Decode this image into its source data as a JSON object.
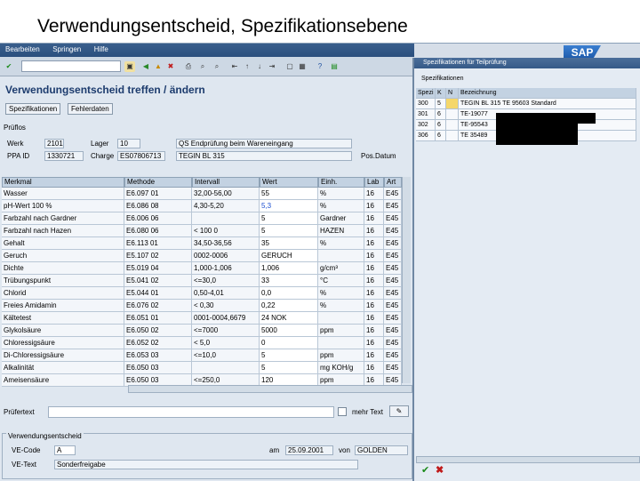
{
  "slide_title": "Verwendungsentscheid, Spezifikationsebene",
  "menu": [
    "Bearbeiten",
    "Springen",
    "Hilfe"
  ],
  "app_title": "Verwendungsentscheid treffen / ändern",
  "buttons": {
    "specs": "Spezifikationen",
    "defects": "Fehlerdaten"
  },
  "pruefung": {
    "group_label": "Prüflos",
    "werk_label": "Werk",
    "werk": "2101",
    "lager_label": "Lager",
    "lager": "10",
    "desc": "QS Endprüfung beim Wareneingang",
    "ppa_label": "PPA ID",
    "ppa": "1330721",
    "charge_label": "Charge",
    "charge": "ES07806713",
    "material": "TEGIN BL 315",
    "pos_label": "Pos.Datum"
  },
  "grid": {
    "headers": [
      "Merkmal",
      "Methode",
      "Intervall",
      "Wert",
      "Einh.",
      "Lab",
      "Art"
    ],
    "rows": [
      [
        "Wasser",
        "E6.097 01",
        "32,00-56,00",
        "55",
        "%",
        "16",
        "E45"
      ],
      [
        "pH-Wert 100 %",
        "E6.086 08",
        "4,30-5,20",
        "5,3",
        "%",
        "16",
        "E45"
      ],
      [
        "Farbzahl nach Gardner",
        "E6.006 06",
        "",
        "5",
        "Gardner",
        "16",
        "E45"
      ],
      [
        "Farbzahl nach Hazen",
        "E6.080 06",
        "< 100 0",
        "5",
        "HAZEN",
        "16",
        "E45"
      ],
      [
        "Gehalt",
        "E6.113 01",
        "34,50-36,56",
        "35",
        "%",
        "16",
        "E45"
      ],
      [
        "Geruch",
        "E5.107 02",
        "0002-0006",
        "GERUCH",
        "",
        "16",
        "E45"
      ],
      [
        "Dichte",
        "E5.019 04",
        "1,000-1,006",
        "1,006",
        "g/cm³",
        "16",
        "E45"
      ],
      [
        "Trübungspunkt",
        "E5.041 02",
        "<=30,0",
        "33",
        "°C",
        "16",
        "E45"
      ],
      [
        "Chlorid",
        "E5.044 01",
        "0,50-4,01",
        "0,0",
        "%",
        "16",
        "E45"
      ],
      [
        "Freies Amidamin",
        "E6.076 02",
        "< 0,30",
        "0,22",
        "%",
        "16",
        "E45"
      ],
      [
        "Kältetest",
        "E6.051 01",
        "0001-0004,6679",
        "24 NOK",
        "",
        "16",
        "E45"
      ],
      [
        "Glykolsäure",
        "E6.050 02",
        "<=7000",
        "5000",
        "ppm",
        "16",
        "E45"
      ],
      [
        "Chloressigsäure",
        "E6.052 02",
        "< 5,0",
        "0",
        "",
        "16",
        "E45"
      ],
      [
        "Di-Chloressigsäure",
        "E6.053 03",
        "<=10,0",
        "5",
        "ppm",
        "16",
        "E45"
      ],
      [
        "Alkalinität",
        "E6.050 03",
        "",
        "5",
        "mg KOH/g",
        "16",
        "E45"
      ],
      [
        "Ameisensäure",
        "E6.050 03",
        "<=250,0",
        "120",
        "ppm",
        "16",
        "E45"
      ]
    ]
  },
  "pruefext_label": "Prüfertext",
  "mehrtext_label": "mehr Text",
  "ve": {
    "group_label": "Verwendungsentscheid",
    "code_label": "VE-Code",
    "code": "A",
    "text_label": "VE-Text",
    "text": "Sonderfreigabe",
    "am_label": "am",
    "am": "25.09.2001",
    "von_label": "von",
    "von": "GOLDEN"
  },
  "popup": {
    "title": "Spezifikationen für Teilprüfung",
    "tab": "Spezifikationen",
    "headers": [
      "Spezi",
      "K",
      "N",
      "Bezeichnung"
    ],
    "rows": [
      [
        "300",
        "5",
        "",
        "TEGIN BL 315 TE 95603 Standard"
      ],
      [
        "301",
        "6",
        "",
        "TE-19077"
      ],
      [
        "302",
        "6",
        "",
        "TE-95543"
      ],
      [
        "306",
        "6",
        "",
        "TE 35489"
      ]
    ]
  },
  "colors": {
    "accent": "#1d3c6e",
    "ok": "#1a8a1a",
    "cancel": "#c01a1a"
  }
}
